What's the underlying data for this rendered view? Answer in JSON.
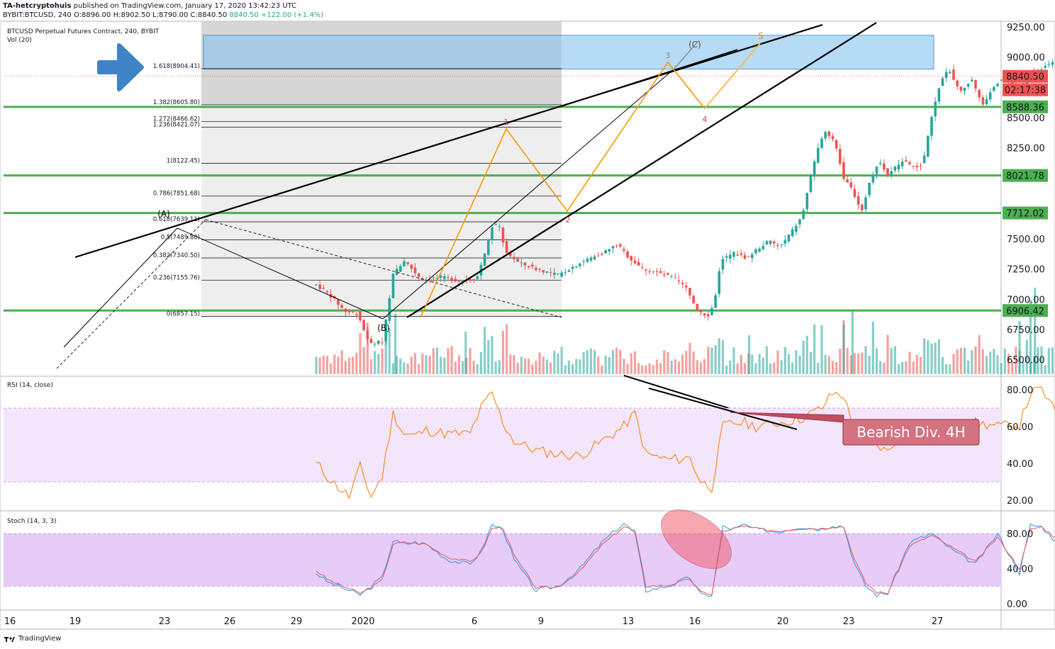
{
  "header": {
    "publisher": "TA-hetcryptohuis",
    "published_text": " published on TradingView.com, January 17, 2020 13:42:23 UTC",
    "symbol_line": "BYBIT:BTCUSD, 240",
    "ohlc": {
      "o": "O:8896.00",
      "h": "H:8902.50",
      "l": "L:8790.00",
      "c": "C:8840.50"
    },
    "change": "8840.50  +122.00 (+1.4%)"
  },
  "legend": {
    "title": "BTCUSD Perpetual Futures Contract, 240, BYBIT",
    "volume": "Vol (20)",
    "rsi": "RSI (14, close)",
    "stoch": "Stoch (14, 3, 3)"
  },
  "price_labels": {
    "current": "8840.50",
    "countdown": "02:17:38",
    "level_8588": "8588.36",
    "level_8021": "8021.78",
    "level_7712": "7712.02",
    "level_6906": "6906.42"
  },
  "annotation": {
    "bearish": "Bearish Div. 4H"
  },
  "waves": {
    "A": "(A)",
    "B": "(B)",
    "C": "(C)",
    "w1": "1",
    "w2": "2",
    "w3": "3",
    "w4": "4",
    "w5": "5"
  },
  "fib_labels": [
    "1.618(8904.41)",
    "1.382(8605.80)",
    "1.272(8466.62)",
    "1.236(8421.07)",
    "1(8122.45)",
    "0.786(7851.68)",
    "0.618(7639.11)",
    "0.5(7489.80)",
    "0.382(7340.50)",
    "0.236(7155.76)",
    "0(6857.15)"
  ],
  "footer": {
    "brand": "TradingView"
  },
  "colors": {
    "up": "#26a69a",
    "down": "#ef5350",
    "support": "#4caf50",
    "zone": "#90c8f0",
    "rsi": "#f57c00",
    "band": "#f3e5fb",
    "stoch_band": "#e8ccf8",
    "arrow": "#3d85c6"
  },
  "chart_data": [
    {
      "type": "candlestick",
      "title": "BTCUSD Perpetual Futures Contract, 240, BYBIT",
      "x_ticks": [
        "16",
        "19",
        "23",
        "26",
        "29",
        "2020",
        "6",
        "9",
        "13",
        "16",
        "20",
        "23",
        "27"
      ],
      "y_ticks": [
        6500,
        6750,
        7000,
        7250,
        7500,
        7750,
        8000,
        8250,
        8500,
        8750,
        9000,
        9250
      ],
      "y_tick_labels": [
        "6500.00",
        "6750.00",
        "7000.00",
        "7250.00",
        "7500.00",
        "",
        "",
        "8250.00",
        "8500.00",
        "",
        "9000.00",
        "9250.00"
      ],
      "ylim": [
        6390,
        9300
      ],
      "horizontal_levels": [
        8588.36,
        8021.78,
        7712.02,
        6906.42
      ],
      "resistance_zone": [
        8900,
        9180
      ],
      "fib_levels": [
        8904.41,
        8605.8,
        8466.62,
        8421.07,
        8122.45,
        7851.68,
        7639.11,
        7489.8,
        7340.5,
        7155.76,
        6857.15
      ],
      "price_path_days": [
        15.0,
        15.6,
        16.3,
        16.9,
        17.4,
        18.0,
        18.5,
        19.0,
        19.8,
        20.7,
        21.5,
        22.3,
        22.7,
        23.0,
        23.3,
        23.6,
        24.2,
        25.0,
        26.0,
        27.0,
        28.0,
        28.7,
        29.3,
        29.9,
        30.5,
        31.2,
        31.8,
        32.3,
        32.8,
        33.1,
        33.4,
        34.0,
        34.6,
        35.1,
        35.6,
        36.1,
        36.6,
        37.1,
        37.6,
        38.1,
        38.6,
        39.0,
        39.4,
        39.8,
        40.2,
        40.6,
        41.0,
        41.4,
        41.8,
        42.2,
        42.6,
        43.0,
        43.4,
        43.8,
        44.3,
        44.8,
        45.3,
        45.8,
        46.3,
        46.9,
        47.4,
        47.9,
        48.4,
        48.9,
        49.4,
        49.8,
        50.2,
        50.6,
        51.0,
        51.4
      ],
      "price_path": [
        7120,
        7040,
        6900,
        6880,
        6630,
        6650,
        7200,
        7320,
        7160,
        7180,
        7150,
        7170,
        7400,
        7600,
        7620,
        7400,
        7300,
        7250,
        7200,
        7300,
        7380,
        7450,
        7330,
        7250,
        7220,
        7180,
        7100,
        6920,
        6860,
        6960,
        7320,
        7380,
        7340,
        7420,
        7480,
        7430,
        7550,
        7680,
        8100,
        8400,
        8300,
        8000,
        7900,
        7720,
        7980,
        8150,
        8020,
        8100,
        8150,
        8080,
        8120,
        8500,
        8800,
        8900,
        8700,
        8820,
        8600,
        8760,
        8840,
        8720,
        8840,
        8900,
        8950,
        8996,
        8840,
        8840,
        8840,
        8840,
        8840,
        8840
      ]
    },
    {
      "type": "line",
      "title": "RSI (14, close)",
      "y_ticks": [
        20,
        40,
        60,
        80
      ],
      "y_tick_labels": [
        "20.00",
        "40.00",
        "60.00",
        "80.00"
      ],
      "band": [
        30,
        70
      ],
      "days": [
        15.0,
        15.5,
        16.0,
        16.5,
        17.0,
        17.5,
        18.0,
        18.5,
        19.0,
        19.5,
        20.0,
        21.0,
        22.0,
        22.5,
        23.0,
        23.5,
        24.0,
        25.0,
        26.0,
        27.0,
        28.0,
        29.0,
        29.5,
        30.0,
        31.0,
        32.0,
        32.5,
        33.0,
        33.5,
        34.0,
        34.5,
        35.0,
        36.0,
        37.0,
        38.0,
        38.5,
        39.0,
        39.5,
        40.0,
        40.5,
        41.0,
        42.0,
        43.0,
        44.0,
        45.0,
        46.0,
        47.0,
        47.5,
        48.0,
        48.5,
        49.0,
        49.5,
        50.0,
        50.5,
        51.0
      ],
      "values": [
        40,
        33,
        27,
        22,
        38,
        22,
        33,
        67,
        56,
        55,
        58,
        56,
        56,
        70,
        78,
        62,
        52,
        47,
        45,
        44,
        52,
        60,
        67,
        45,
        42,
        43,
        30,
        27,
        60,
        62,
        62,
        60,
        62,
        64,
        70,
        78,
        77,
        56,
        52,
        50,
        46,
        65,
        55,
        58,
        62,
        60,
        61,
        78,
        80,
        70,
        60,
        62,
        60,
        68,
        64
      ]
    },
    {
      "type": "line",
      "title": "Stoch (14, 3, 3)",
      "y_ticks": [
        0,
        40,
        80
      ],
      "y_tick_labels": [
        "0.00",
        "40.00",
        "80.00"
      ],
      "band": [
        20,
        80
      ],
      "days": [
        15.0,
        15.5,
        16.0,
        16.5,
        17.0,
        17.5,
        18.0,
        18.5,
        19.0,
        19.5,
        20.0,
        21.0,
        22.0,
        22.5,
        23.0,
        23.5,
        24.0,
        25.0,
        26.0,
        27.0,
        28.0,
        29.0,
        29.5,
        30.0,
        31.0,
        32.0,
        32.5,
        33.0,
        33.5,
        34.0,
        34.5,
        35.0,
        36.0,
        37.0,
        38.0,
        38.5,
        39.0,
        39.5,
        40.0,
        40.5,
        41.0,
        42.0,
        43.0,
        44.0,
        45.0,
        46.0,
        47.0,
        47.5,
        48.0,
        48.5,
        49.0,
        49.5,
        50.0,
        50.5,
        51.0
      ],
      "k_values": [
        35,
        25,
        20,
        15,
        10,
        20,
        30,
        72,
        68,
        70,
        68,
        50,
        45,
        60,
        90,
        85,
        50,
        15,
        20,
        40,
        70,
        92,
        80,
        15,
        20,
        30,
        10,
        10,
        88,
        85,
        90,
        85,
        82,
        88,
        85,
        90,
        88,
        45,
        20,
        10,
        12,
        70,
        80,
        60,
        45,
        80,
        35,
        90,
        88,
        75,
        70,
        80,
        50,
        48,
        72
      ],
      "d_values": [
        38,
        28,
        22,
        17,
        12,
        18,
        27,
        68,
        70,
        69,
        68,
        53,
        48,
        58,
        86,
        87,
        55,
        18,
        19,
        37,
        67,
        88,
        83,
        20,
        21,
        28,
        13,
        11,
        82,
        86,
        88,
        86,
        83,
        86,
        86,
        88,
        88,
        50,
        24,
        13,
        12,
        66,
        78,
        63,
        48,
        76,
        40,
        85,
        88,
        78,
        72,
        78,
        55,
        50,
        68
      ]
    }
  ]
}
